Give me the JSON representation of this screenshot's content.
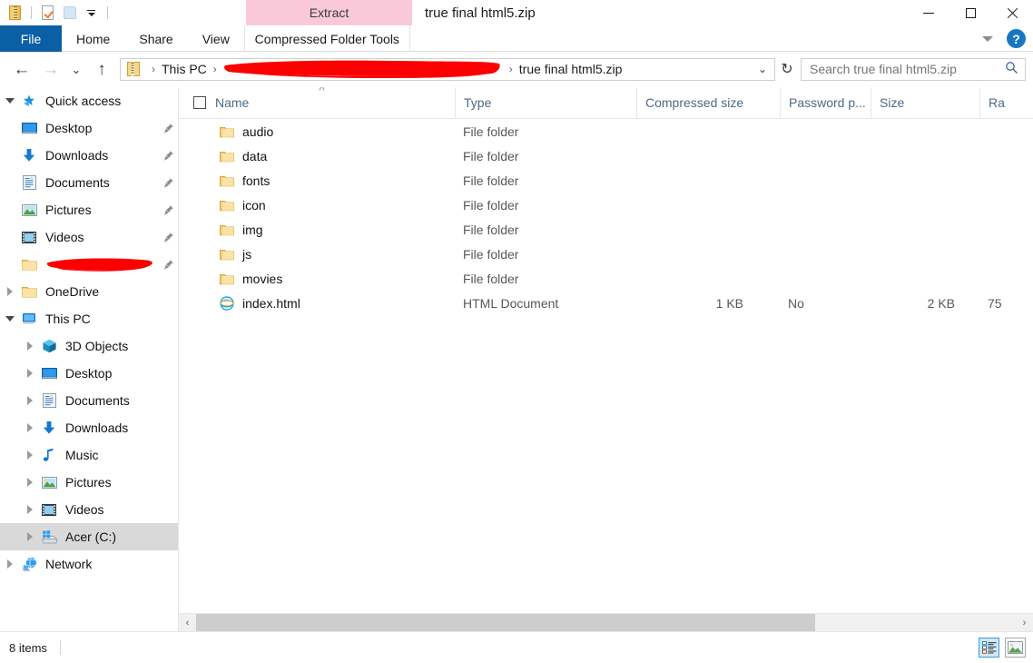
{
  "window": {
    "title": "true final html5.zip",
    "quick_access_toolbar": [
      {
        "name": "zip-archive-icon",
        "label": "Archive"
      },
      {
        "name": "properties-icon",
        "label": "Properties"
      },
      {
        "name": "new-folder-icon",
        "label": "New folder"
      },
      {
        "name": "customize-chevron-icon",
        "label": "Customize Quick Access Toolbar"
      }
    ],
    "controls": {
      "minimize": "Minimize",
      "maximize": "Maximize",
      "close": "Close"
    }
  },
  "ribbon": {
    "contextual_header": "Extract",
    "contextual_header_color": "#f9c9da",
    "tabs": [
      {
        "label": "File",
        "active_color": "#0b5fa5"
      },
      {
        "label": "Home"
      },
      {
        "label": "Share"
      },
      {
        "label": "View"
      },
      {
        "label": "Compressed Folder Tools"
      }
    ],
    "expand_label": "Expand the Ribbon",
    "help_label": "?"
  },
  "address": {
    "back_icon": "←",
    "forward_icon": "→",
    "recent_icon": "⌄",
    "up_icon": "↑",
    "crumbs": [
      {
        "label": "This PC",
        "redacted": false
      },
      {
        "label": "",
        "redacted": true
      },
      {
        "label": "true final html5.zip",
        "redacted": false
      }
    ],
    "separator": "›",
    "dropdown_icon": "⌄",
    "refresh_icon": "↻",
    "redaction_color": "#fc0000"
  },
  "search": {
    "value": "Search true final html5.zip",
    "placeholder": "Search true final html5.zip",
    "icon": "search-icon"
  },
  "sidebar": {
    "groups": [
      {
        "label": "Quick access",
        "icon": "quick-access-star-icon",
        "expanded": true,
        "items": [
          {
            "label": "Desktop",
            "icon": "desktop-icon",
            "pinned": true
          },
          {
            "label": "Downloads",
            "icon": "downloads-arrow-icon",
            "pinned": true
          },
          {
            "label": "Documents",
            "icon": "documents-icon",
            "pinned": true
          },
          {
            "label": "Pictures",
            "icon": "pictures-icon",
            "pinned": true
          },
          {
            "label": "Videos",
            "icon": "videos-icon",
            "pinned": true
          },
          {
            "label": "",
            "icon": "folder-icon",
            "pinned": true,
            "redacted": true
          }
        ]
      },
      {
        "label": "OneDrive",
        "icon": "onedrive-folder-icon",
        "expanded": false,
        "items": []
      },
      {
        "label": "This PC",
        "icon": "this-pc-icon",
        "expanded": true,
        "items": [
          {
            "label": "3D Objects",
            "icon": "3d-objects-icon"
          },
          {
            "label": "Desktop",
            "icon": "desktop-icon"
          },
          {
            "label": "Documents",
            "icon": "documents-icon"
          },
          {
            "label": "Downloads",
            "icon": "downloads-arrow-icon"
          },
          {
            "label": "Music",
            "icon": "music-note-icon"
          },
          {
            "label": "Pictures",
            "icon": "pictures-icon"
          },
          {
            "label": "Videos",
            "icon": "videos-icon"
          },
          {
            "label": "Acer (C:)",
            "icon": "local-disk-icon",
            "selected": true
          }
        ]
      },
      {
        "label": "Network",
        "icon": "network-icon",
        "expanded": false,
        "items": []
      }
    ]
  },
  "file_list": {
    "columns": [
      {
        "key": "name",
        "label": "Name",
        "sorted": "asc",
        "sort_caret": "˄"
      },
      {
        "key": "type",
        "label": "Type"
      },
      {
        "key": "compressed_size",
        "label": "Compressed size"
      },
      {
        "key": "password_protected",
        "label": "Password p..."
      },
      {
        "key": "size",
        "label": "Size"
      },
      {
        "key": "ratio",
        "label": "Ra"
      }
    ],
    "rows": [
      {
        "name": "audio",
        "icon": "folder-icon",
        "type": "File folder",
        "compressed_size": "",
        "password_protected": "",
        "size": "",
        "ratio": ""
      },
      {
        "name": "data",
        "icon": "folder-icon",
        "type": "File folder",
        "compressed_size": "",
        "password_protected": "",
        "size": "",
        "ratio": ""
      },
      {
        "name": "fonts",
        "icon": "folder-icon",
        "type": "File folder",
        "compressed_size": "",
        "password_protected": "",
        "size": "",
        "ratio": ""
      },
      {
        "name": "icon",
        "icon": "folder-icon",
        "type": "File folder",
        "compressed_size": "",
        "password_protected": "",
        "size": "",
        "ratio": ""
      },
      {
        "name": "img",
        "icon": "folder-icon",
        "type": "File folder",
        "compressed_size": "",
        "password_protected": "",
        "size": "",
        "ratio": ""
      },
      {
        "name": "js",
        "icon": "folder-icon",
        "type": "File folder",
        "compressed_size": "",
        "password_protected": "",
        "size": "",
        "ratio": ""
      },
      {
        "name": "movies",
        "icon": "folder-icon",
        "type": "File folder",
        "compressed_size": "",
        "password_protected": "",
        "size": "",
        "ratio": ""
      },
      {
        "name": "index.html",
        "icon": "html-document-icon",
        "type": "HTML Document",
        "compressed_size": "1 KB",
        "password_protected": "No",
        "size": "2 KB",
        "ratio": "75"
      }
    ],
    "scrollbar": {
      "left_arrow": "‹",
      "right_arrow": "›"
    }
  },
  "statusbar": {
    "item_count": "8 items",
    "view_buttons": [
      {
        "name": "details-view-button",
        "label": "Details view",
        "active": true
      },
      {
        "name": "large-icons-view-button",
        "label": "Large icons view",
        "active": false
      }
    ]
  }
}
